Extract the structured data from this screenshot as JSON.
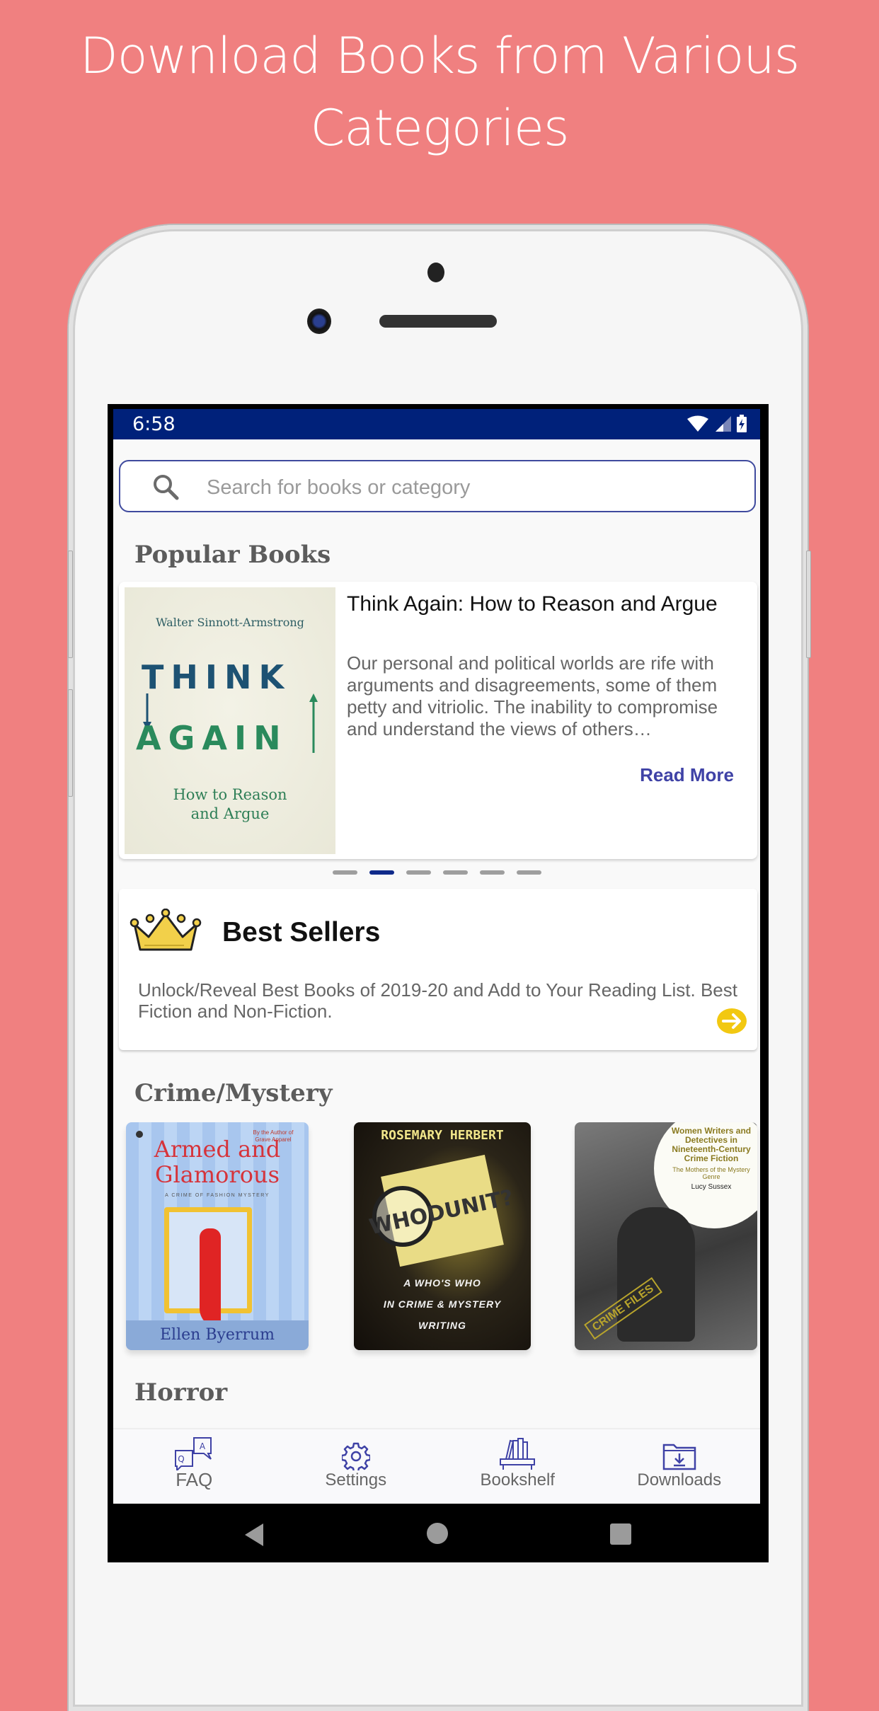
{
  "headline": {
    "line1": "Download Books from Various",
    "line2": "Categories"
  },
  "status_bar": {
    "time": "6:58",
    "icons": [
      "wifi-icon",
      "signal-icon",
      "battery-charging-icon"
    ]
  },
  "search": {
    "placeholder": "Search for books or category",
    "value": ""
  },
  "popular": {
    "title": "Popular Books",
    "featured": {
      "cover_author": "Walter Sinnott-Armstrong",
      "cover_word1": "THINK",
      "cover_word2": "AGAIN",
      "cover_subtitle_line1": "How to Reason",
      "cover_subtitle_line2": "and Argue",
      "title": "Think Again: How to Reason and Argue",
      "description": "Our personal and political worlds are rife with arguments and disagreements, some of them petty and vitriolic. The inability to compromise and understand the views of others…",
      "read_more": "Read More"
    },
    "carousel": {
      "count": 6,
      "active_index": 1
    }
  },
  "best_sellers": {
    "title": "Best Sellers",
    "description": "Unlock/Reveal Best Books of 2019-20 and Add to Your Reading List. Best Fiction and Non-Fiction.",
    "icon": "crown-icon",
    "action_icon": "arrow-right-circle-icon"
  },
  "categories": [
    {
      "title": "Crime/Mystery",
      "books": [
        {
          "cover_title_line1": "Armed and",
          "cover_title_line2": "Glamorous",
          "cover_tagline": "A CRIME OF FASHION MYSTERY",
          "cover_byline": "By the Author of Grave Apparel",
          "cover_author": "Ellen Byerrum"
        },
        {
          "cover_author": "ROSEMARY HERBERT",
          "cover_title": "WHODUNIT?",
          "cover_subtitle_line1": "A WHO'S WHO",
          "cover_subtitle_line2": "IN CRIME & MYSTERY",
          "cover_subtitle_line3": "WRITING"
        },
        {
          "cover_title": "Women Writers and Detectives in Nineteenth-Century Crime Fiction",
          "cover_subtitle": "The Mothers of the Mystery Genre",
          "cover_author": "Lucy Sussex",
          "cover_stamp": "CRIME FILES"
        }
      ]
    },
    {
      "title": "Horror",
      "books": []
    }
  ],
  "bottom_nav": [
    {
      "label": "FAQ",
      "icon": "faq-icon"
    },
    {
      "label": "Settings",
      "icon": "gear-icon"
    },
    {
      "label": "Bookshelf",
      "icon": "bookshelf-icon"
    },
    {
      "label": "Downloads",
      "icon": "download-folder-icon"
    }
  ],
  "colors": {
    "background": "#F08080",
    "status_bar": "#00217A",
    "accent": "#3F42A6",
    "active_dot": "#0F2A8A",
    "crown": "#F2D04A",
    "arrow": "#F2C811"
  }
}
